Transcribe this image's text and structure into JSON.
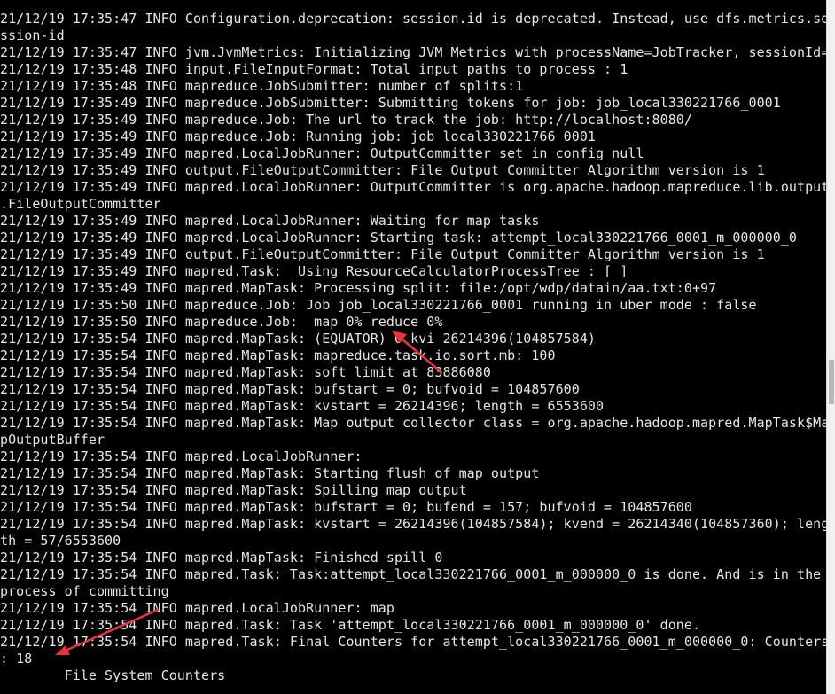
{
  "terminal": {
    "lines": [
      "21/12/19 17:35:47 INFO Configuration.deprecation: session.id is deprecated. Instead, use dfs.metrics.se",
      "ssion-id",
      "21/12/19 17:35:47 INFO jvm.JvmMetrics: Initializing JVM Metrics with processName=JobTracker, sessionId=",
      "21/12/19 17:35:48 INFO input.FileInputFormat: Total input paths to process : 1",
      "21/12/19 17:35:48 INFO mapreduce.JobSubmitter: number of splits:1",
      "21/12/19 17:35:49 INFO mapreduce.JobSubmitter: Submitting tokens for job: job_local330221766_0001",
      "21/12/19 17:35:49 INFO mapreduce.Job: The url to track the job: http://localhost:8080/",
      "21/12/19 17:35:49 INFO mapreduce.Job: Running job: job_local330221766_0001",
      "21/12/19 17:35:49 INFO mapred.LocalJobRunner: OutputCommitter set in config null",
      "21/12/19 17:35:49 INFO output.FileOutputCommitter: File Output Committer Algorithm version is 1",
      "21/12/19 17:35:49 INFO mapred.LocalJobRunner: OutputCommitter is org.apache.hadoop.mapreduce.lib.output",
      ".FileOutputCommitter",
      "21/12/19 17:35:49 INFO mapred.LocalJobRunner: Waiting for map tasks",
      "21/12/19 17:35:49 INFO mapred.LocalJobRunner: Starting task: attempt_local330221766_0001_m_000000_0",
      "21/12/19 17:35:49 INFO output.FileOutputCommitter: File Output Committer Algorithm version is 1",
      "21/12/19 17:35:49 INFO mapred.Task:  Using ResourceCalculatorProcessTree : [ ]",
      "21/12/19 17:35:49 INFO mapred.MapTask: Processing split: file:/opt/wdp/datain/aa.txt:0+97",
      "21/12/19 17:35:50 INFO mapreduce.Job: Job job_local330221766_0001 running in uber mode : false",
      "21/12/19 17:35:50 INFO mapreduce.Job:  map 0% reduce 0%",
      "21/12/19 17:35:54 INFO mapred.MapTask: (EQUATOR) 0 kvi 26214396(104857584)",
      "21/12/19 17:35:54 INFO mapred.MapTask: mapreduce.task.io.sort.mb: 100",
      "21/12/19 17:35:54 INFO mapred.MapTask: soft limit at 83886080",
      "21/12/19 17:35:54 INFO mapred.MapTask: bufstart = 0; bufvoid = 104857600",
      "21/12/19 17:35:54 INFO mapred.MapTask: kvstart = 26214396; length = 6553600",
      "21/12/19 17:35:54 INFO mapred.MapTask: Map output collector class = org.apache.hadoop.mapred.MapTask$Ma",
      "pOutputBuffer",
      "21/12/19 17:35:54 INFO mapred.LocalJobRunner:",
      "21/12/19 17:35:54 INFO mapred.MapTask: Starting flush of map output",
      "21/12/19 17:35:54 INFO mapred.MapTask: Spilling map output",
      "21/12/19 17:35:54 INFO mapred.MapTask: bufstart = 0; bufend = 157; bufvoid = 104857600",
      "21/12/19 17:35:54 INFO mapred.MapTask: kvstart = 26214396(104857584); kvend = 26214340(104857360); leng",
      "th = 57/6553600",
      "21/12/19 17:35:54 INFO mapred.MapTask: Finished spill 0",
      "21/12/19 17:35:54 INFO mapred.Task: Task:attempt_local330221766_0001_m_000000_0 is done. And is in the",
      "process of committing",
      "21/12/19 17:35:54 INFO mapred.LocalJobRunner: map",
      "21/12/19 17:35:54 INFO mapred.Task: Task 'attempt_local330221766_0001_m_000000_0' done.",
      "21/12/19 17:35:54 INFO mapred.Task: Final Counters for attempt_local330221766_0001_m_000000_0: Counters",
      ": 18",
      "        File System Counters"
    ]
  },
  "colors": {
    "background": "#000000",
    "text": "#e6e6e6",
    "annotation_arrow": "#e8343a",
    "scrollbar_track": "#f0f0f0",
    "scrollbar_thumb": "#b8b8b8"
  },
  "icons": {
    "annotation_1": "red-arrow-icon",
    "annotation_2": "red-arrow-icon"
  }
}
